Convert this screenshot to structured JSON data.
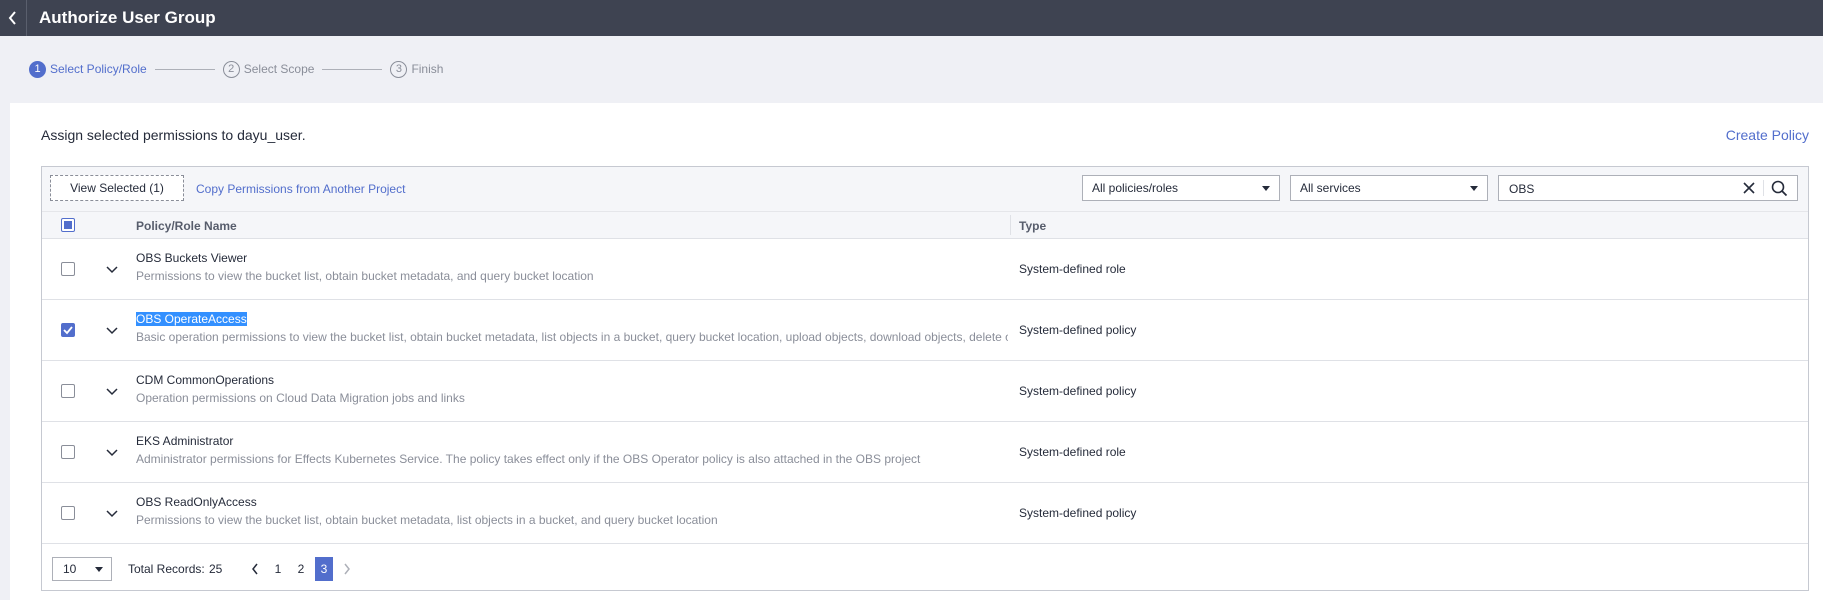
{
  "header": {
    "title": "Authorize User Group"
  },
  "steps": [
    {
      "num": "1",
      "label": "Select Policy/Role",
      "active": true
    },
    {
      "num": "2",
      "label": "Select Scope",
      "active": false
    },
    {
      "num": "3",
      "label": "Finish",
      "active": false
    }
  ],
  "panel": {
    "assign_text": "Assign selected permissions to dayu_user.",
    "create_policy": "Create Policy"
  },
  "toolbar": {
    "view_selected": "View Selected (1)",
    "copy_permissions": "Copy Permissions from Another Project",
    "policy_filter": "All policies/roles",
    "service_filter": "All services",
    "search_value": "OBS"
  },
  "table": {
    "columns": {
      "name": "Policy/Role Name",
      "type": "Type"
    },
    "rows": [
      {
        "name": "OBS Buckets Viewer",
        "desc": "Permissions to view the bucket list, obtain bucket metadata, and query bucket location",
        "type": "System-defined role",
        "checked": false
      },
      {
        "name": "OBS OperateAccess",
        "desc": "Basic operation permissions to view the bucket list, obtain bucket metadata, list objects in a bucket, query bucket location, upload objects, download objects, delete objects, and obtain object ACLs",
        "type": "System-defined policy",
        "checked": true
      },
      {
        "name": "CDM CommonOperations",
        "desc": "Operation permissions on Cloud Data Migration jobs and links",
        "type": "System-defined policy",
        "checked": false
      },
      {
        "name": "EKS Administrator",
        "desc": "Administrator permissions for Effects Kubernetes Service. The policy takes effect only if the OBS Operator policy is also attached in the OBS project",
        "type": "System-defined role",
        "checked": false
      },
      {
        "name": "OBS ReadOnlyAccess",
        "desc": "Permissions to view the bucket list, obtain bucket metadata, list objects in a bucket, and query bucket location",
        "type": "System-defined policy",
        "checked": false
      }
    ]
  },
  "pagination": {
    "page_size": "10",
    "total_label": "Total Records:",
    "total_count": "25",
    "pages": [
      "1",
      "2",
      "3"
    ],
    "current_page": "3"
  },
  "colors": {
    "accent": "#526ecc",
    "header_bg": "#3e4351",
    "highlight": "#3390ff"
  }
}
